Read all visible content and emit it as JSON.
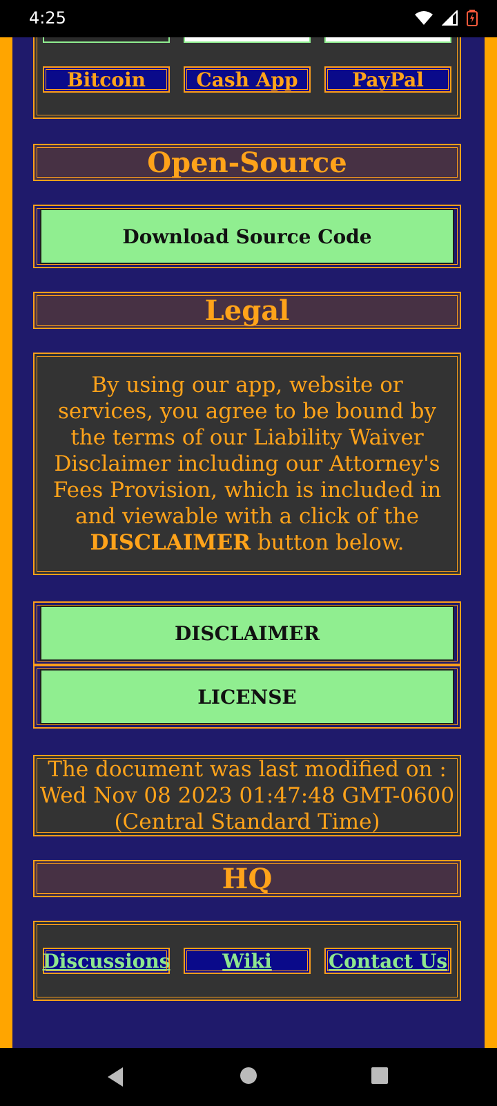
{
  "status": {
    "time": "4:25"
  },
  "donate": {
    "buttons": [
      {
        "label": "Bitcoin"
      },
      {
        "label": "Cash App"
      },
      {
        "label": "PayPal"
      }
    ]
  },
  "open_source": {
    "heading": "Open-Source",
    "download_label": "Download Source Code"
  },
  "legal": {
    "heading": "Legal",
    "text_before": "By using our app, website or services, you agree to be bound by the terms of our Liability Waiver Disclaimer including our Attorney's Fees Provision, which is included in and viewable with a click of the",
    "text_bold": "DISCLAIMER",
    "text_after": " button below.",
    "disclaimer_label": "DISCLAIMER",
    "license_label": "LICENSE"
  },
  "modified": {
    "text": "The document was last modified on : Wed Nov 08 2023 01:47:48 GMT-0600 (Central Standard Time)"
  },
  "hq": {
    "heading": "HQ",
    "links": [
      {
        "label": "Discussions"
      },
      {
        "label": "Wiki"
      },
      {
        "label": "Contact Us"
      }
    ]
  },
  "colors": {
    "accent": "#ffa31a",
    "button_green": "#90ee90",
    "link_green": "#8ee68e",
    "nav_blue": "#0a0a8a"
  }
}
